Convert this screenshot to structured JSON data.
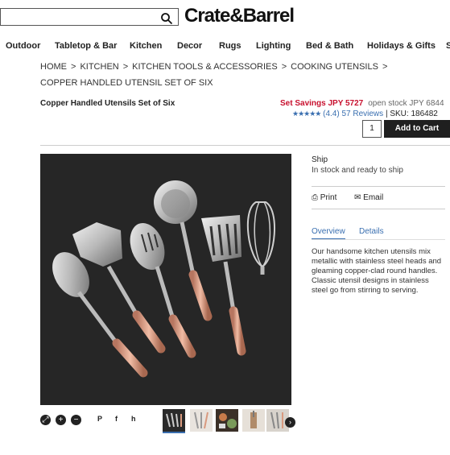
{
  "header": {
    "logo": "Crate&Barrel",
    "search_placeholder": ""
  },
  "nav": [
    "Outdoor",
    "Tabletop & Bar",
    "Kitchen",
    "Decor",
    "Rugs",
    "Lighting",
    "Bed & Bath",
    "Holidays & Gifts",
    "S"
  ],
  "breadcrumb": {
    "items": [
      "HOME",
      "KITCHEN",
      "KITCHEN TOOLS & ACCESSORIES",
      "COOKING UTENSILS"
    ],
    "sep": ">",
    "current": "COPPER HANDLED UTENSIL SET OF SIX"
  },
  "product": {
    "title": "Copper Handled Utensils Set of Six",
    "sale_price": "Set Savings JPY 5727",
    "open_stock": "open stock JPY 6844",
    "stars": "★★★★★",
    "rating": "(4.4)",
    "reviews": "57 Reviews",
    "sku": "|  SKU: 186482",
    "quantity": "1",
    "add_to_cart": "Add to Cart"
  },
  "shipping": {
    "label": "Ship",
    "status": "In stock and ready to ship"
  },
  "actions": {
    "print": "Print",
    "email": "Email"
  },
  "tabs": {
    "overview": "Overview",
    "details": "Details"
  },
  "description": "Our handsome kitchen utensils mix metallic with stainless steel heads and gleaming copper-clad round handles. Classic utensil designs in stainless steel go from stirring to serving.",
  "share": {
    "pinterest": "P",
    "facebook": "f",
    "houzz": "h"
  },
  "colors": {
    "accent_blue": "#3a6fb0",
    "sale_red": "#c8102e",
    "copper": "#d99a7f",
    "button_dark": "#1f1f1f"
  }
}
